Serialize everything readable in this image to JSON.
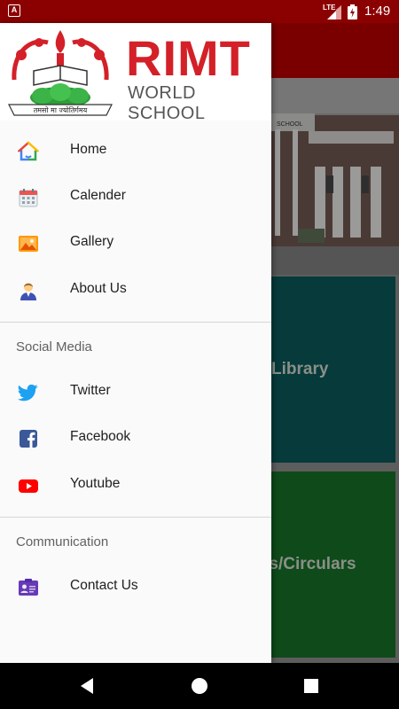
{
  "status_bar": {
    "time": "1:49",
    "network": "LTE",
    "app_icon_letter": "A"
  },
  "background": {
    "library_label": "Library",
    "news_label": "rs/Circulars",
    "photo_sign": "SCHOOL"
  },
  "drawer": {
    "logo": {
      "brand": "RIMT",
      "subtitle": "WORLD SCHOOL",
      "motto": "तमसो मा ज्योतिर्गमय"
    },
    "main_items": [
      {
        "label": "Home",
        "icon": "home-icon"
      },
      {
        "label": "Calender",
        "icon": "calendar-icon"
      },
      {
        "label": "Gallery",
        "icon": "gallery-icon"
      },
      {
        "label": "About Us",
        "icon": "person-icon"
      }
    ],
    "social_section": {
      "title": "Social Media",
      "items": [
        {
          "label": "Twitter",
          "icon": "twitter-icon"
        },
        {
          "label": "Facebook",
          "icon": "facebook-icon"
        },
        {
          "label": "Youtube",
          "icon": "youtube-icon"
        }
      ]
    },
    "communication_section": {
      "title": "Communication",
      "items": [
        {
          "label": "Contact Us",
          "icon": "contact-card-icon"
        }
      ]
    }
  },
  "colors": {
    "status_bar": "#8b0000",
    "brand_red": "#d42028",
    "twitter": "#1da1f2",
    "facebook": "#3b5998",
    "youtube": "#ff0000"
  }
}
